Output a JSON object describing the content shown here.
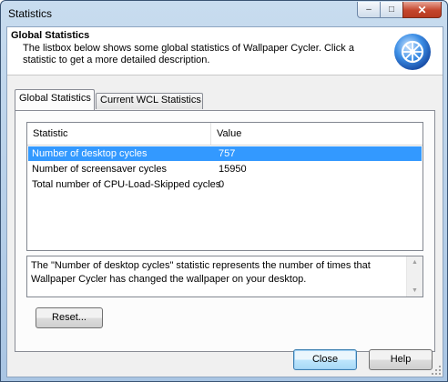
{
  "window": {
    "title": "Statistics",
    "minimize_symbol": "–",
    "maximize_symbol": "□",
    "close_symbol": "✕"
  },
  "header": {
    "title": "Global Statistics",
    "description": "The listbox below shows some global statistics of Wallpaper Cycler. Click a statistic to get a more detailed description.",
    "icon": "wallpaper-cycler-logo-icon"
  },
  "tabs": [
    {
      "label": "Global Statistics",
      "active": true
    },
    {
      "label": "Current WCL Statistics",
      "active": false
    }
  ],
  "list": {
    "columns": [
      "Statistic",
      "Value"
    ],
    "rows": [
      {
        "statistic": "Number of desktop cycles",
        "value": "757",
        "selected": true
      },
      {
        "statistic": "Number of screensaver cycles",
        "value": "15950",
        "selected": false
      },
      {
        "statistic": "Total number of CPU-Load-Skipped cycles",
        "value": "0",
        "selected": false
      }
    ]
  },
  "description_box": {
    "text": "The \"Number of desktop cycles\" statistic represents the number of times that Wallpaper Cycler has changed the wallpaper on your desktop."
  },
  "buttons": {
    "reset": "Reset...",
    "close": "Close",
    "help": "Help"
  },
  "colors": {
    "selection": "#3399ff",
    "title_gradient_top": "#c8dcef",
    "close_button": "#c4452c"
  }
}
